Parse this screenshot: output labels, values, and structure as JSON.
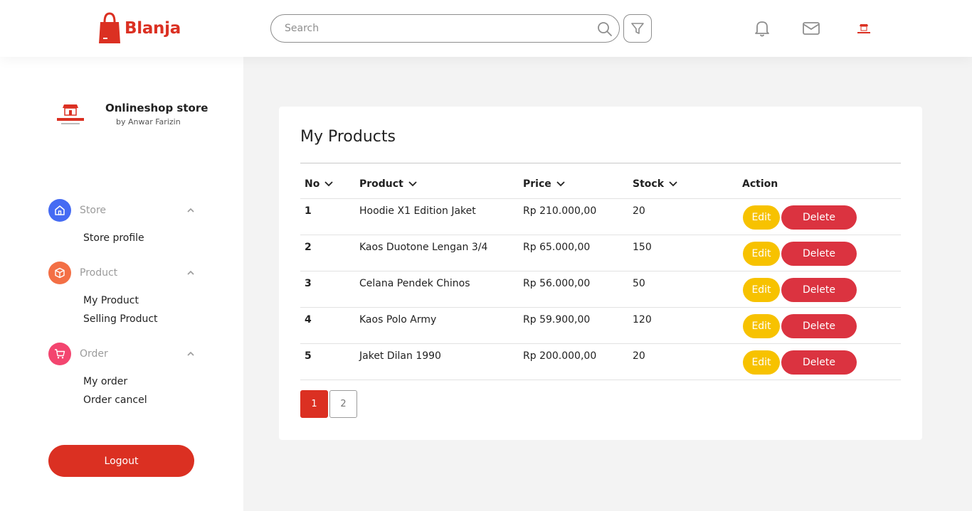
{
  "header": {
    "brand": "Blanja",
    "search_placeholder": "Search"
  },
  "sidebar": {
    "store_name": "Onlineshop store",
    "store_by": "by Anwar Farizin",
    "groups": [
      {
        "title": "Store",
        "color": "#456bf3",
        "items": [
          "Store profile"
        ]
      },
      {
        "title": "Product",
        "color": "#f36f45",
        "items": [
          "My Product",
          "Selling Product"
        ]
      },
      {
        "title": "Order",
        "color": "#f3456f",
        "items": [
          "My order",
          "Order cancel"
        ]
      }
    ],
    "logout_label": "Logout"
  },
  "main": {
    "title": "My Products",
    "columns": [
      "No",
      "Product",
      "Price",
      "Stock",
      "Action"
    ],
    "rows": [
      {
        "no": "1",
        "product": "Hoodie X1 Edition Jaket",
        "price": "Rp 210.000,00",
        "stock": "20"
      },
      {
        "no": "2",
        "product": "Kaos Duotone Lengan 3/4",
        "price": "Rp 65.000,00",
        "stock": "150"
      },
      {
        "no": "3",
        "product": "Celana Pendek Chinos",
        "price": "Rp 56.000,00",
        "stock": "50"
      },
      {
        "no": "4",
        "product": "Kaos Polo Army",
        "price": "Rp 59.900,00",
        "stock": "120"
      },
      {
        "no": "5",
        "product": "Jaket Dilan 1990",
        "price": "Rp 200.000,00",
        "stock": "20"
      }
    ],
    "edit_label": "Edit",
    "delete_label": "Delete",
    "pages": [
      "1",
      "2"
    ],
    "current_page": "1"
  },
  "colors": {
    "brand": "#db3022",
    "edit": "#f7c200",
    "delete": "#db3340"
  },
  "icons": [
    "shopping-bag-icon",
    "search-icon",
    "filter-icon",
    "bell-icon",
    "mail-icon",
    "home-icon",
    "box-icon",
    "cart-icon",
    "chevron-up-icon",
    "chevron-down-icon"
  ]
}
